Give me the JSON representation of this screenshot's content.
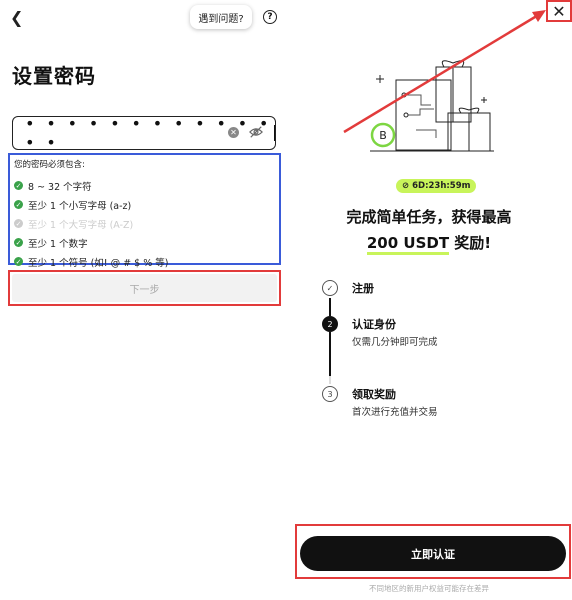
{
  "left": {
    "help_button": "遇到问题?",
    "help_icon": "?",
    "title": "设置密码",
    "password": {
      "masked_value": "• • • • • • • • • • • • • •"
    },
    "rules_heading": "您的密码必须包含:",
    "rules": [
      {
        "text": "8 ~ 32 个字符",
        "met": true
      },
      {
        "text": "至少 1 个小写字母 (a-z)",
        "met": true
      },
      {
        "text": "至少 1 个大写字母 (A-Z)",
        "met": false
      },
      {
        "text": "至少 1 个数字",
        "met": true
      },
      {
        "text": "至少 1 个符号 (如! @ # $ % 等)",
        "met": true
      }
    ],
    "next_button": "下一步"
  },
  "right": {
    "timer": "6D:23h:59m",
    "promo_line1": "完成简单任务，获得最高",
    "promo_amount": "200 USDT",
    "promo_suffix": " 奖励!",
    "steps": [
      {
        "num": "",
        "label": "注册",
        "sub": "",
        "state": "done"
      },
      {
        "num": "2",
        "label": "认证身份",
        "sub": "仅需几分钟即可完成",
        "state": "active"
      },
      {
        "num": "3",
        "label": "领取奖励",
        "sub": "首次进行充值并交易",
        "state": "pending"
      }
    ],
    "cta_button": "立即认证",
    "footnote": "不同地区的新用户权益可能存在差异"
  },
  "icons": {
    "back": "chevron-left-icon",
    "help": "question-circle-icon",
    "clear": "clear-circle-icon",
    "eye": "eye-off-icon",
    "check": "check-circle-icon",
    "close": "close-icon",
    "clock": "clock-icon"
  },
  "colors": {
    "annotation_red": "#e23b3b",
    "annotation_blue": "#3a5bd9",
    "check_green": "#3aa24a",
    "accent_lime": "#c8f45a"
  }
}
